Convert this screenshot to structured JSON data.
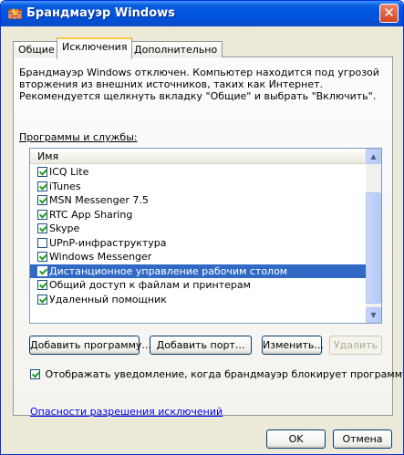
{
  "window": {
    "title": "Брандмауэр Windows",
    "close_glyph": "✕"
  },
  "tabs": [
    {
      "label": "Общие",
      "active": false
    },
    {
      "label": "Исключения",
      "active": true
    },
    {
      "label": "Дополнительно",
      "active": false
    }
  ],
  "description": "Брандмауэр Windows отключен. Компьютер находится под угрозой вторжения из внешних источников, таких как Интернет. Рекомендуется щелкнуть вкладку \"Общие\" и выбрать \"Включить\".",
  "programs_label": "Программы и службы:",
  "list": {
    "column_header": "Имя",
    "items": [
      {
        "label": "ICQ Lite",
        "checked": true,
        "selected": false
      },
      {
        "label": "iTunes",
        "checked": true,
        "selected": false
      },
      {
        "label": "MSN Messenger 7.5",
        "checked": true,
        "selected": false
      },
      {
        "label": "RTC App Sharing",
        "checked": true,
        "selected": false
      },
      {
        "label": "Skype",
        "checked": true,
        "selected": false
      },
      {
        "label": "UPnP-инфраструктура",
        "checked": false,
        "selected": false
      },
      {
        "label": "Windows Messenger",
        "checked": true,
        "selected": false
      },
      {
        "label": "Дистанционное управление рабочим столом",
        "checked": true,
        "selected": true
      },
      {
        "label": "Общий доступ к файлам и принтерам",
        "checked": true,
        "selected": false
      },
      {
        "label": "Удаленный помощник",
        "checked": true,
        "selected": false
      }
    ]
  },
  "buttons": {
    "add_program": "Добавить программу...",
    "add_port": "Добавить порт...",
    "edit": "Изменить...",
    "remove": "Удалить",
    "ok": "OK",
    "cancel": "Отмена"
  },
  "notify": {
    "label": "Отображать уведомление, когда брандмауэр блокирует программу",
    "checked": true
  },
  "risk_link": "Опасности разрешения исключений",
  "colors": {
    "titlebar": "#0054e3",
    "selection": "#316ac5",
    "window_bg": "#ece9d8",
    "link": "#0000ff"
  }
}
